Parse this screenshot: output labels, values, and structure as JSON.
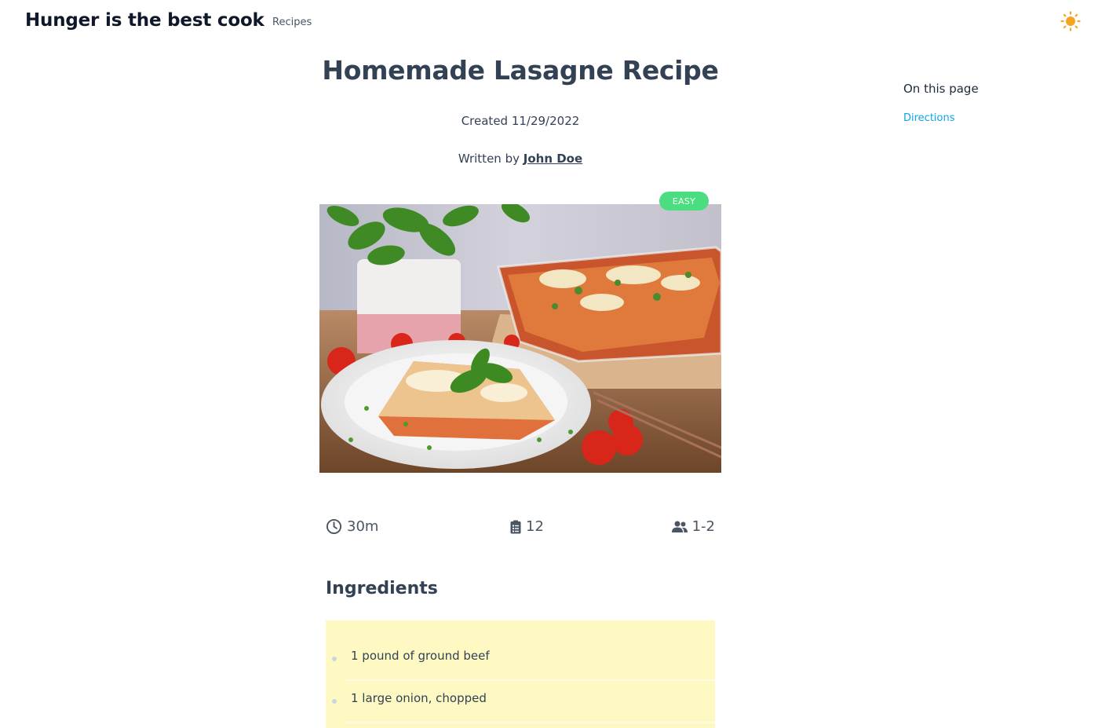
{
  "site": {
    "title": "Hunger is the best cook"
  },
  "nav": {
    "recipes_label": "Recipes"
  },
  "header": {
    "theme_icon": "sun-icon"
  },
  "recipe": {
    "title": "Homemade Lasagne Recipe",
    "created": "Created 11/29/2022",
    "written_by_prefix": "Written by",
    "author": "John Doe",
    "difficulty": "EASY",
    "image_icon": "lasagna-photo",
    "stats": {
      "time": "30m",
      "ingredients_count": "12",
      "servings": "1-2"
    }
  },
  "ingredients": {
    "heading": "Ingredients",
    "items": [
      "1 pound of ground beef",
      "1 large onion, chopped"
    ]
  },
  "toc": {
    "title": "On this page",
    "items": [
      "Directions"
    ]
  },
  "colors": {
    "badge": "#4ade80",
    "ingredients_bg": "#fef9c3",
    "link": "#0ea5e9",
    "sun": "#f5a524"
  }
}
